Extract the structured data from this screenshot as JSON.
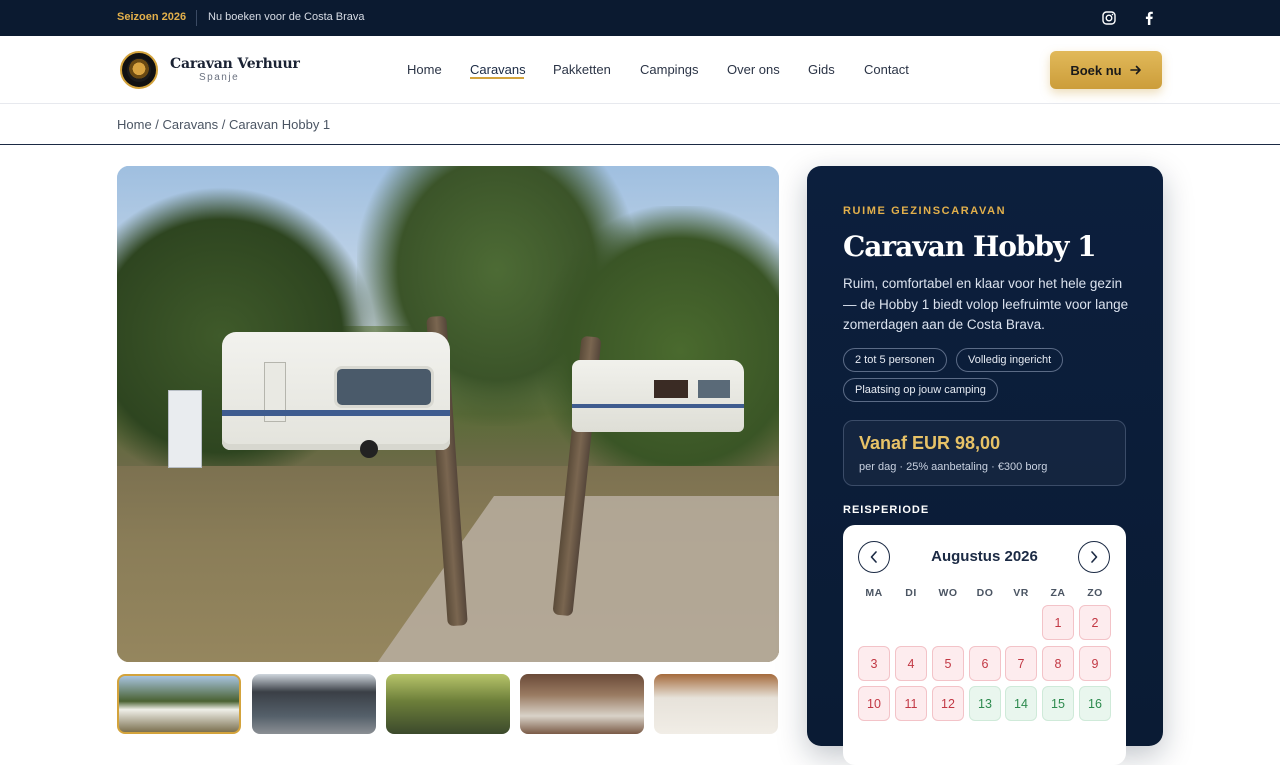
{
  "topbar": {
    "season": "Seizoen 2026",
    "message": "Nu boeken voor de Costa Brava",
    "social": [
      "instagram-icon",
      "facebook-icon"
    ]
  },
  "header": {
    "brand_title": "Caravan Verhuur",
    "brand_sub": "Spanje",
    "nav": [
      "Home",
      "Caravans",
      "Pakketten",
      "Campings",
      "Over ons",
      "Gids",
      "Contact"
    ],
    "active_nav": "Caravans",
    "cta_label": "Boek nu",
    "cta_icon": "arrow-right-icon"
  },
  "breadcrumb": "Home / Caravans / Caravan Hobby 1",
  "gallery": {
    "main_image": "caravan-photo",
    "thumbnails": 5,
    "selected_thumbnail": 1
  },
  "booking": {
    "eyebrow": "RUIME GEZINSCARAVAN",
    "title": "Caravan Hobby 1",
    "description": "Ruim, comfortabel en klaar voor het hele gezin — de Hobby 1 biedt volop leefruimte voor lange zomerdagen aan de Costa Brava.",
    "chips": [
      "2 tot 5 personen",
      "Volledig ingericht",
      "Plaatsing op jouw camping"
    ],
    "price": "Vanaf EUR 98,00",
    "price_sub": "per dag · 25% aanbetaling · €300 borg",
    "period_label": "REISPERIODE",
    "calendar": {
      "month": "Augustus 2026",
      "prev_icon": "chevron-left-icon",
      "next_icon": "chevron-right-icon",
      "weekdays": [
        "MA",
        "DI",
        "WO",
        "DO",
        "VR",
        "ZA",
        "ZO"
      ],
      "days": [
        "1",
        "2",
        "3",
        "4",
        "5",
        "6",
        "7",
        "8",
        "9",
        "10",
        "11",
        "12",
        "13",
        "14",
        "15",
        "16"
      ],
      "status_colors": {
        "busy": "#c23844",
        "free": "#2d8a4e"
      }
    }
  },
  "colors": {
    "navy": "#0b1a30",
    "gold": "#d3a33c"
  }
}
